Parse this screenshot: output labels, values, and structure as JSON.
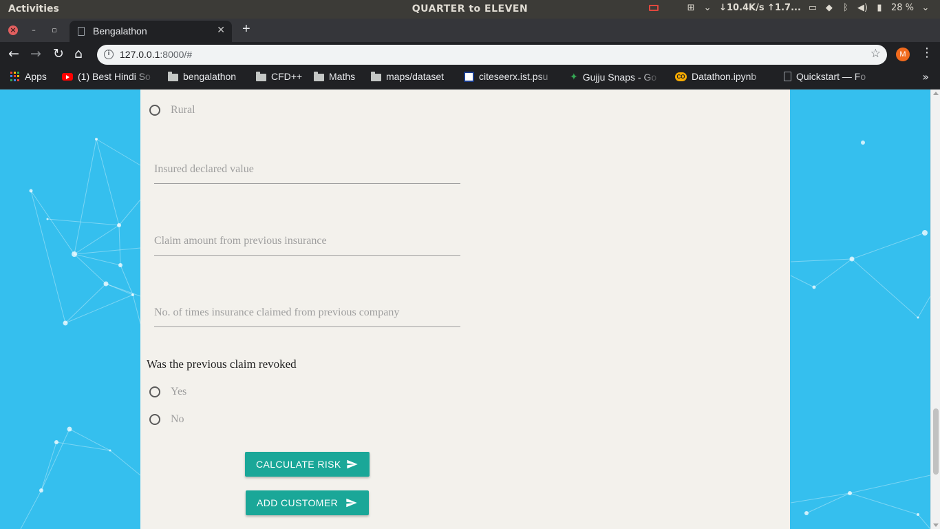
{
  "system": {
    "activities": "Activities",
    "clock": "QUARTER to ELEVEN",
    "network_speed": "↓10.4K/s ↑1.7...",
    "battery": "28 %"
  },
  "browser": {
    "tab_title": "Bengalathon",
    "url_host": "127.0.0.1",
    "url_rest": ":8000/#",
    "profile_initial": "M"
  },
  "bookmarks": [
    {
      "label": "Apps",
      "icon": "apps-grid-icon"
    },
    {
      "label": "(1) Best Hindi So",
      "icon": "youtube-icon"
    },
    {
      "label": "bengalathon",
      "icon": "folder-icon"
    },
    {
      "label": "CFD++",
      "icon": "folder-icon"
    },
    {
      "label": "Maths",
      "icon": "folder-icon"
    },
    {
      "label": "maps/dataset",
      "icon": "folder-icon"
    },
    {
      "label": "citeseerx.ist.psu",
      "icon": "citeseerx-icon"
    },
    {
      "label": "Gujju Snaps - Go",
      "icon": "pinwheel-icon"
    },
    {
      "label": "Datathon.ipynb",
      "icon": "colab-icon"
    },
    {
      "label": "Quickstart — Fo",
      "icon": "document-icon"
    }
  ],
  "form": {
    "area_option_rural": "Rural",
    "insured_declared_value_placeholder": "Insured declared value",
    "claim_amount_placeholder": "Claim amount from previous insurance",
    "times_claimed_placeholder": "No. of times insurance claimed from previous company",
    "revoked_question": "Was the previous claim revoked",
    "revoked_yes": "Yes",
    "revoked_no": "No",
    "calculate_risk_label": "CALCULATE RISK",
    "add_customer_label": "ADD CUSTOMER"
  },
  "colors": {
    "page_background": "#35bfee",
    "card_background": "#f3f1ec",
    "button_teal": "#1aa798"
  }
}
